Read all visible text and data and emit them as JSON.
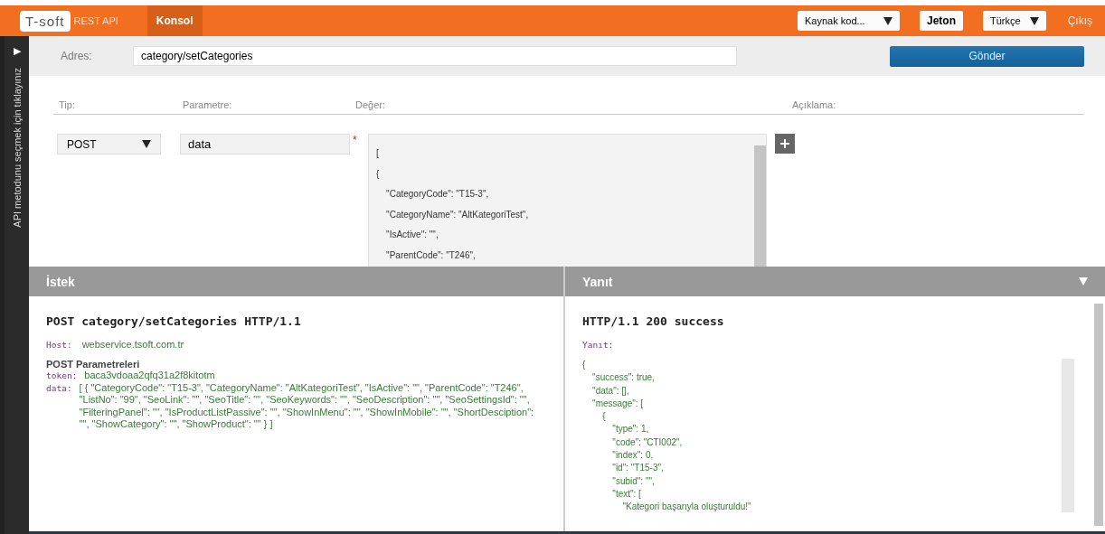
{
  "header": {
    "logo": "T-soft",
    "product": "REST API",
    "nav": [
      {
        "label": "Konsol",
        "selected": true
      }
    ],
    "source_select": "Kaynak kod...",
    "token_button": "Jeton",
    "language_select": "Türkçe",
    "logout": "Çıkış"
  },
  "sidebar": {
    "expand_icon": "▶",
    "label": "API metodunu seçmek için tıklayınız"
  },
  "address": {
    "label": "Adres:",
    "value": "category/setCategories",
    "send_button": "Gönder"
  },
  "params": {
    "columns": [
      "Tip:",
      "Parametre:",
      "Değer:",
      "Açıklama:"
    ],
    "row": {
      "type": "POST",
      "name": "data",
      "required_mark": "*",
      "value_lines": [
        "[",
        "{",
        "    \"CategoryCode\": \"T15-3\",",
        "    \"CategoryName\": \"AltKategoriTest\",",
        "    \"IsActive\": \"\",",
        "    \"ParentCode\": \"T246\","
      ]
    }
  },
  "request": {
    "title": "İstek",
    "request_line": "POST category/setCategories HTTP/1.1",
    "host_label": "Host:",
    "host": "webservice.tsoft.com.tr",
    "params_title": "POST Parametreleri",
    "fields": [
      {
        "key": "token:",
        "value": "baca3vdoaa2qfq31a2f8kitotm"
      },
      {
        "key": "data:",
        "value": "[ { \"CategoryCode\": \"T15-3\", \"CategoryName\": \"AltKategoriTest\", \"IsActive\": \"\", \"ParentCode\": \"T246\", \"ListNo\": \"99\", \"SeoLink\": \"\", \"SeoTitle\": \"\", \"SeoKeywords\": \"\", \"SeoDescription\": \"\", \"SeoSettingsId\": \"\", \"FilteringPanel\": \"\", \"IsProductListPassive\": \"\", \"ShowInMenu\": \"\", \"ShowInMobile\": \"\", \"ShortDesciption\": \"\", \"ShowCategory\": \"\", \"ShowProduct\": \"\" } ]"
      }
    ]
  },
  "response": {
    "title": "Yanıt",
    "status_line": "HTTP/1.1 200 success",
    "body_label": "Yanıt:",
    "body_lines": [
      "{",
      "    \"success\": true,",
      "    \"data\": [],",
      "    \"message\": [",
      "        {",
      "            \"type\": 1,",
      "            \"code\": \"CTI002\",",
      "            \"index\": 0,",
      "            \"id\": \"T15-3\",",
      "            \"subid\": \"\",",
      "            \"text\": [",
      "                \"Kategori başarıyla oluşturuldu!\""
    ]
  }
}
